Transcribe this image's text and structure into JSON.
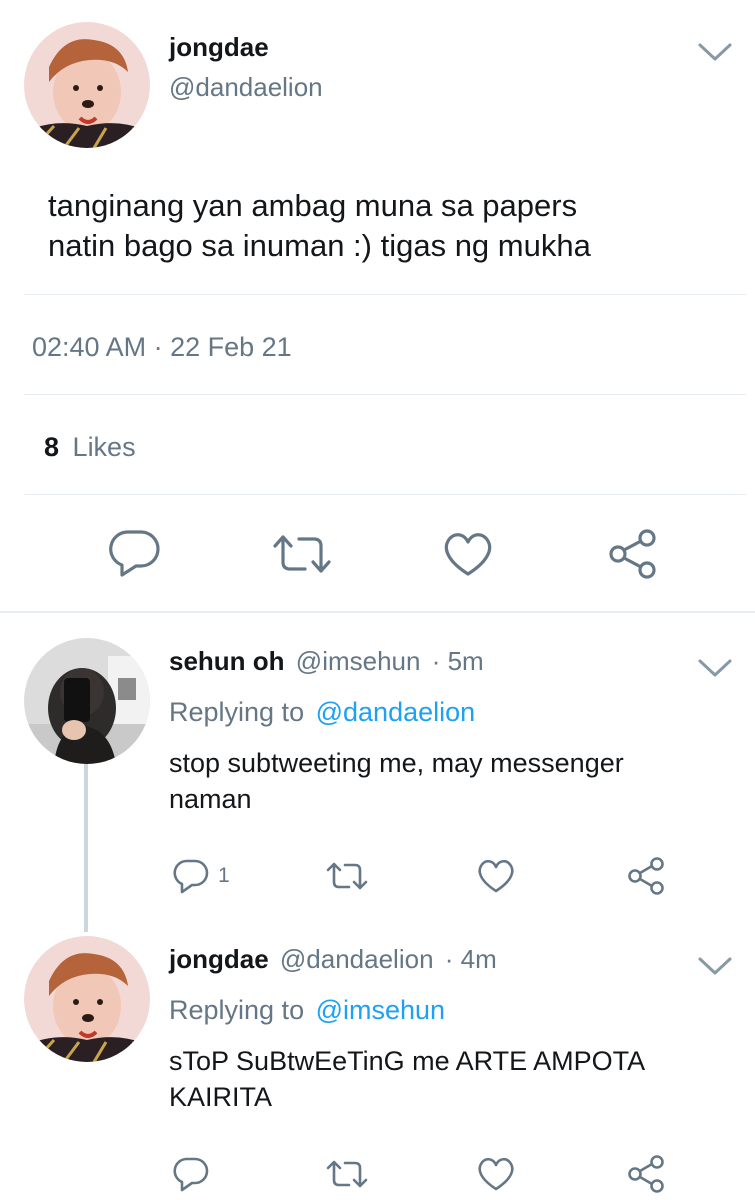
{
  "main_tweet": {
    "display_name": "jongdae",
    "handle": "@dandaelion",
    "text_line1": "tanginang yan ambag muna sa papers",
    "text_line2": "natin bago sa inuman :) tigas ng mukha",
    "timestamp": "02:40 AM · 22 Feb 21",
    "likes_count": "8",
    "likes_label": "Likes"
  },
  "replies": [
    {
      "display_name": "sehun oh",
      "handle": "@imsehun",
      "time": "· 5m",
      "replying_prefix": "Replying to",
      "replying_handle": "@dandaelion",
      "text_line1": "stop subtweeting me, may messenger",
      "text_line2": "naman",
      "reply_count": "1"
    },
    {
      "display_name": "jongdae",
      "handle": "@dandaelion",
      "time": "· 4m",
      "replying_prefix": "Replying to",
      "replying_handle": "@imsehun",
      "text_line1": "sToP SuBtwEeTinG me ARTE AMPOTA",
      "text_line2": "KAIRITA"
    }
  ],
  "icons": [
    "chevron-down-icon",
    "reply-icon",
    "retweet-icon",
    "like-icon",
    "share-icon"
  ],
  "colors": {
    "accent": "#1da1f2",
    "secondary_text": "#657786",
    "divider": "#e6ecf0"
  }
}
